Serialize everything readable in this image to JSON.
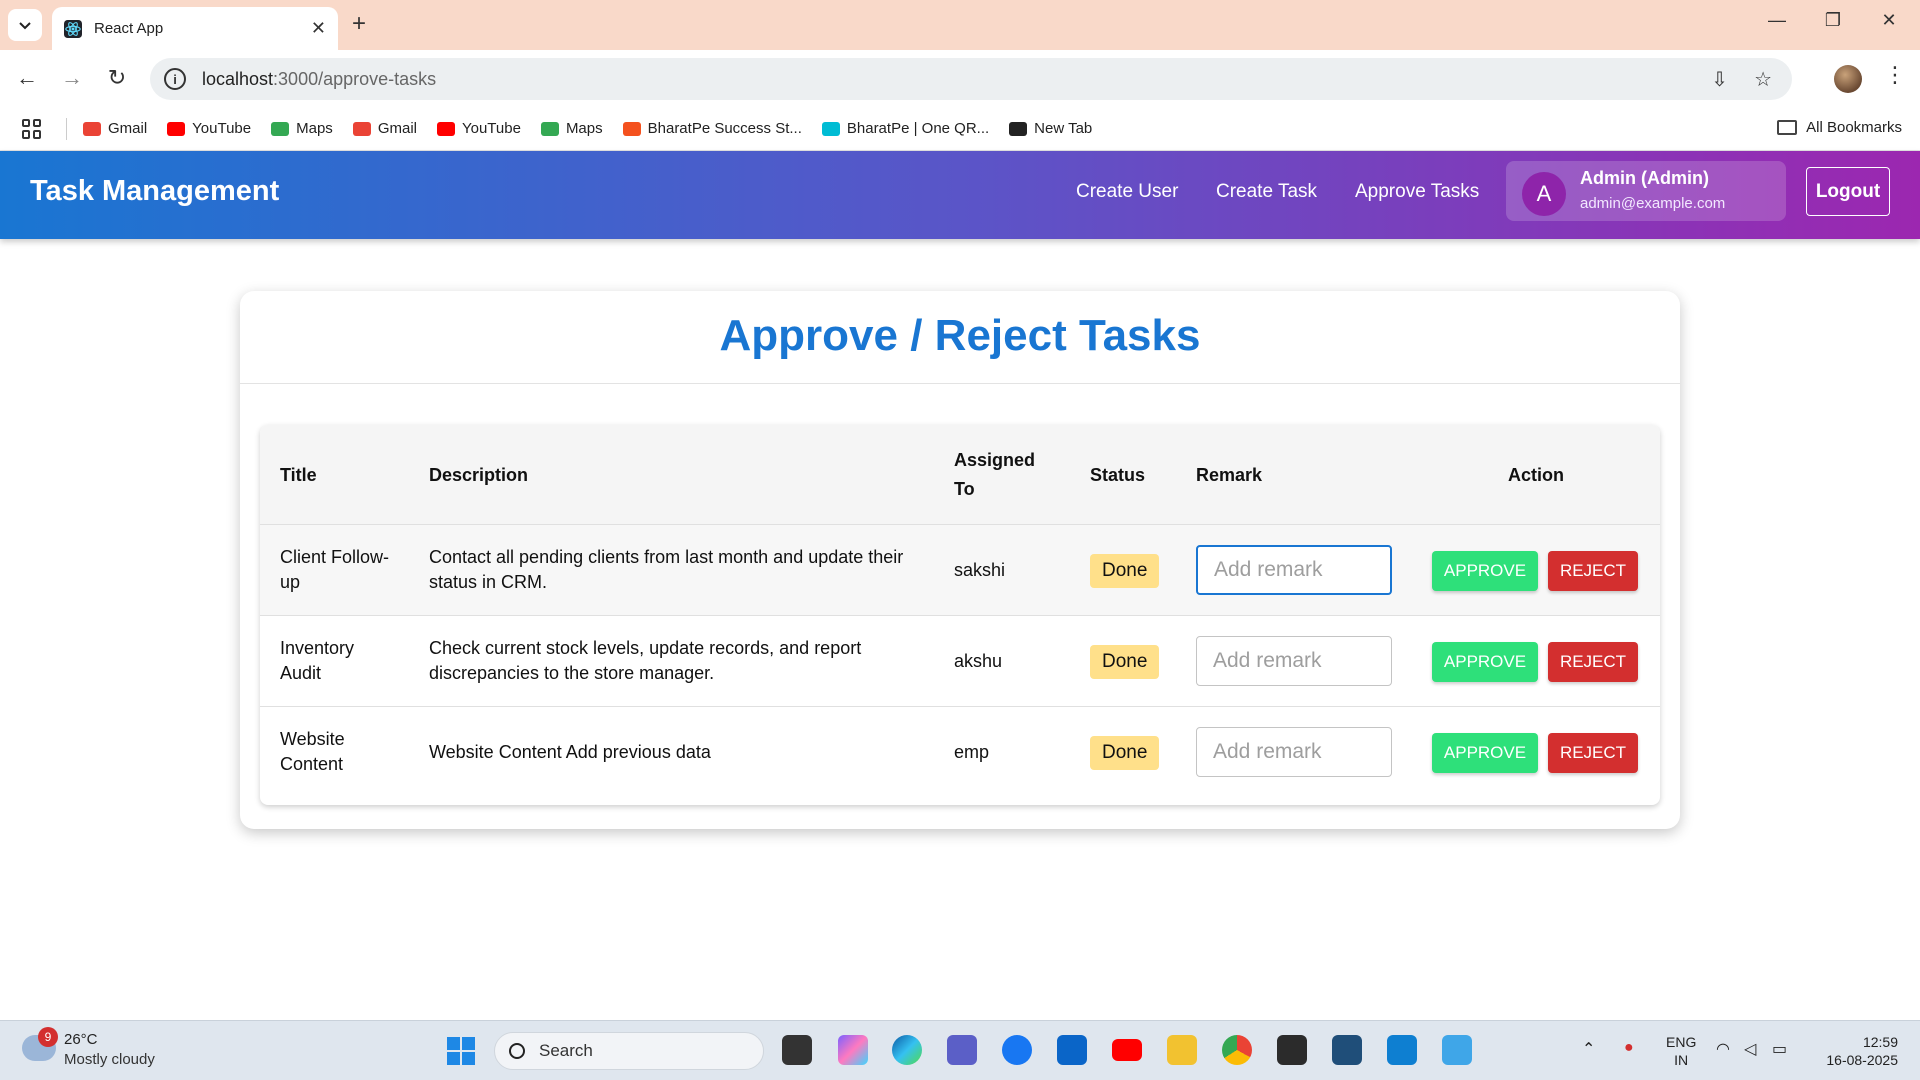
{
  "browser": {
    "tab_title": "React App",
    "url_host": "localhost",
    "url_path": ":3000/approve-tasks",
    "bookmarks": [
      {
        "label": "Gmail",
        "color": "#ea4335"
      },
      {
        "label": "YouTube",
        "color": "#ff0000"
      },
      {
        "label": "Maps",
        "color": "#34a853"
      },
      {
        "label": "Gmail",
        "color": "#ea4335"
      },
      {
        "label": "YouTube",
        "color": "#ff0000"
      },
      {
        "label": "Maps",
        "color": "#34a853"
      },
      {
        "label": "BharatPe Success St...",
        "color": "#f4511e"
      },
      {
        "label": "BharatPe | One QR...",
        "color": "#00bcd4"
      },
      {
        "label": "New Tab",
        "color": "#222222"
      }
    ],
    "all_bookmarks": "All Bookmarks"
  },
  "header": {
    "brand": "Task Management",
    "nav": [
      "Create User",
      "Create Task",
      "Approve Tasks"
    ],
    "user_initial": "A",
    "user_name": "Admin (Admin)",
    "user_email": "admin@example.com",
    "logout": "Logout",
    "gradient_start": "#1976d2",
    "gradient_end": "#9c27b0"
  },
  "main": {
    "title": "Approve / Reject Tasks",
    "columns": {
      "title": "Title",
      "description": "Description",
      "assigned_line1": "Assigned",
      "assigned_line2": "To",
      "status": "Status",
      "remark": "Remark",
      "action": "Action"
    },
    "rows": [
      {
        "title_l1": "Client Follow-",
        "title_l2": "up",
        "desc_l1": "Contact all pending clients from last month and update their",
        "desc_l2": "status in CRM.",
        "assigned": "sakshi",
        "status": "Done",
        "remark_placeholder": "Add remark",
        "approve": "APPROVE",
        "reject": "REJECT"
      },
      {
        "title_l1": "Inventory",
        "title_l2": "Audit",
        "desc_l1": "Check current stock levels, update records, and report",
        "desc_l2": "discrepancies to the store manager.",
        "assigned": "akshu",
        "status": "Done",
        "remark_placeholder": "Add remark",
        "approve": "APPROVE",
        "reject": "REJECT"
      },
      {
        "title_l1": "Website",
        "title_l2": "Content",
        "desc_l1": "Website Content Add previous data",
        "desc_l2": "",
        "assigned": "emp",
        "status": "Done",
        "remark_placeholder": "Add remark",
        "approve": "APPROVE",
        "reject": "REJECT"
      }
    ],
    "title_color": "#1976d2",
    "approve_color": "#2ee07a",
    "reject_color": "#d32f2f",
    "status_color": "#ffe08a"
  },
  "taskbar": {
    "weather_badge": "9",
    "weather_temp": "26°C",
    "weather_desc": "Mostly cloudy",
    "search": "Search",
    "lang_l1": "ENG",
    "lang_l2": "IN",
    "time": "12:59",
    "date": "16-08-2025"
  }
}
